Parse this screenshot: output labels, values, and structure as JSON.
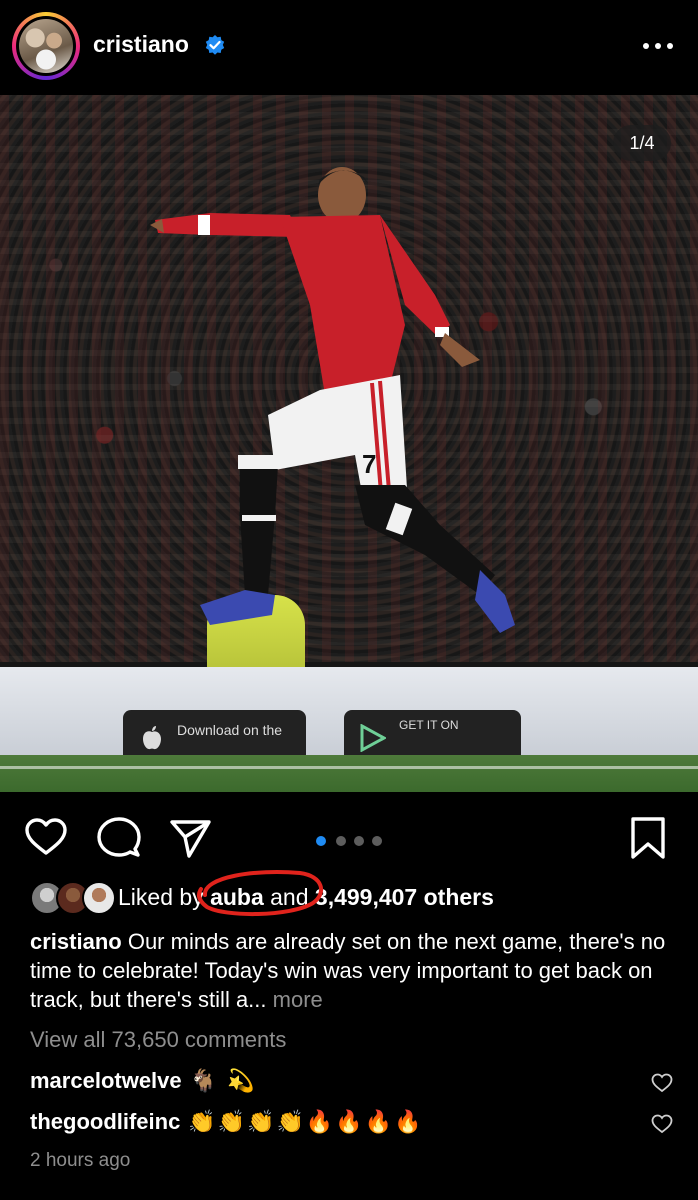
{
  "post": {
    "username": "cristiano",
    "verified": true,
    "verified_icon": "verified-badge-icon",
    "more_icon": "more-horizontal-icon",
    "media": {
      "counter": "1/4",
      "ad_board_left": "Download on the",
      "ad_board_right": "GET IT ON"
    },
    "carousel": {
      "total": 4,
      "current": 1
    },
    "actions": {
      "like_icon": "heart-icon",
      "comment_icon": "comment-icon",
      "share_icon": "send-icon",
      "save_icon": "bookmark-icon"
    },
    "likes": {
      "prefix": "Liked by",
      "liker": "auba",
      "conj": "and",
      "count": "3,499,407 others"
    },
    "caption": {
      "username": "cristiano",
      "text": "Our minds are already set on the next game, there's no time to celebrate! Today's win was very important to get back on track, but there's still a...",
      "more_label": "more"
    },
    "view_comments": "View all 73,650 comments",
    "comments": [
      {
        "user": "marcelotwelve",
        "text": "🐐 💫"
      },
      {
        "user": "thegoodlifeinc",
        "text": "👏👏👏👏🔥🔥🔥🔥"
      }
    ],
    "timestamp": "2 hours ago"
  },
  "colors": {
    "accent": "#1f8bf3",
    "muted": "#8e8e8e",
    "annotation": "#e0231c"
  }
}
